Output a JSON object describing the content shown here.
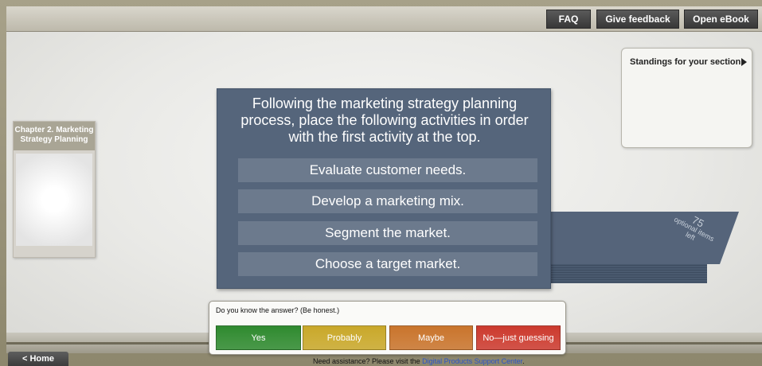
{
  "header": {
    "buttons": [
      "FAQ",
      "Give feedback",
      "Open eBook"
    ]
  },
  "chapter": {
    "title": "Chapter 2. Marketing Strategy Planning"
  },
  "stack": {
    "count": "75",
    "label": "optional items left"
  },
  "question": {
    "prompt": "Following the marketing strategy planning process, place the following activities in order with the first activity at the top.",
    "answers": [
      "Evaluate customer needs.",
      "Develop a marketing mix.",
      "Segment the market.",
      "Choose a target market."
    ]
  },
  "standings": {
    "label": "Standings for your section"
  },
  "confidence": {
    "prompt": "Do you know the answer? (Be honest.)",
    "options": [
      {
        "label": "Yes",
        "color": "#2f8a2f"
      },
      {
        "label": "Probably",
        "color": "#c9a82a"
      },
      {
        "label": "Maybe",
        "color": "#c9742c"
      },
      {
        "label": "No—just guessing",
        "color": "#cc3a2e"
      }
    ]
  },
  "footer": {
    "home_label": "< Home",
    "assist_text": "Need assistance? Please visit the ",
    "assist_link": "Digital Products Support Center",
    "assist_end": "."
  }
}
